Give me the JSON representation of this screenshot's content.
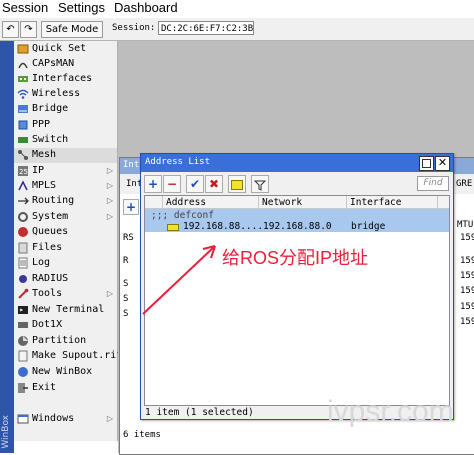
{
  "menu": {
    "session": "Session",
    "settings": "Settings",
    "dashboard": "Dashboard"
  },
  "toolbar": {
    "safe_mode": "Safe Mode",
    "session_label": "Session:",
    "session_value": "DC:2C:6E:F7:C2:3B"
  },
  "brand_strip": "WinBox",
  "sidebar": {
    "items": [
      {
        "label": "Quick Set",
        "icon": "quick-set-icon"
      },
      {
        "label": "CAPsMAN",
        "icon": "capsman-icon"
      },
      {
        "label": "Interfaces",
        "icon": "interfaces-icon"
      },
      {
        "label": "Wireless",
        "icon": "wireless-icon"
      },
      {
        "label": "Bridge",
        "icon": "bridge-icon"
      },
      {
        "label": "PPP",
        "icon": "ppp-icon"
      },
      {
        "label": "Switch",
        "icon": "switch-icon"
      },
      {
        "label": "Mesh",
        "icon": "mesh-icon"
      },
      {
        "label": "IP",
        "icon": "ip-icon"
      },
      {
        "label": "MPLS",
        "icon": "mpls-icon"
      },
      {
        "label": "Routing",
        "icon": "routing-icon"
      },
      {
        "label": "System",
        "icon": "system-icon"
      },
      {
        "label": "Queues",
        "icon": "queues-icon"
      },
      {
        "label": "Files",
        "icon": "files-icon"
      },
      {
        "label": "Log",
        "icon": "log-icon"
      },
      {
        "label": "RADIUS",
        "icon": "radius-icon"
      },
      {
        "label": "Tools",
        "icon": "tools-icon"
      },
      {
        "label": "New Terminal",
        "icon": "terminal-icon"
      },
      {
        "label": "Dot1X",
        "icon": "dot1x-icon"
      },
      {
        "label": "Partition",
        "icon": "partition-icon"
      },
      {
        "label": "Make Supout.rif",
        "icon": "supout-icon"
      },
      {
        "label": "New WinBox",
        "icon": "winbox-icon"
      },
      {
        "label": "Exit",
        "icon": "exit-icon"
      },
      {
        "label": "Windows",
        "icon": "windows-icon"
      }
    ]
  },
  "bg_window": {
    "title": "Int",
    "tab": "Int",
    "gre": "GRE",
    "mtu": "MTU",
    "rows_left": [
      "RS",
      "R",
      "S",
      "S",
      "S"
    ],
    "mtu_values": [
      "159",
      "159",
      "159",
      "159",
      "159",
      "159"
    ],
    "status": "6 items"
  },
  "address_list": {
    "title": "Address List",
    "find_placeholder": "Find",
    "columns": [
      "Address",
      "Network",
      "Interface"
    ],
    "group": ";;; defconf",
    "rows": [
      {
        "address": "192.168.88....",
        "network": "192.168.88.0",
        "interface": "bridge"
      }
    ],
    "status": "1 item (1 selected)"
  },
  "annotation": "给ROS分配IP地址",
  "watermark": "ivpsr.com",
  "colors": {
    "titlebar": "#3b6fd8",
    "selection": "#a9c8ee",
    "annotation": "#e8203a",
    "sidebar_strip": "#2f55a8"
  }
}
